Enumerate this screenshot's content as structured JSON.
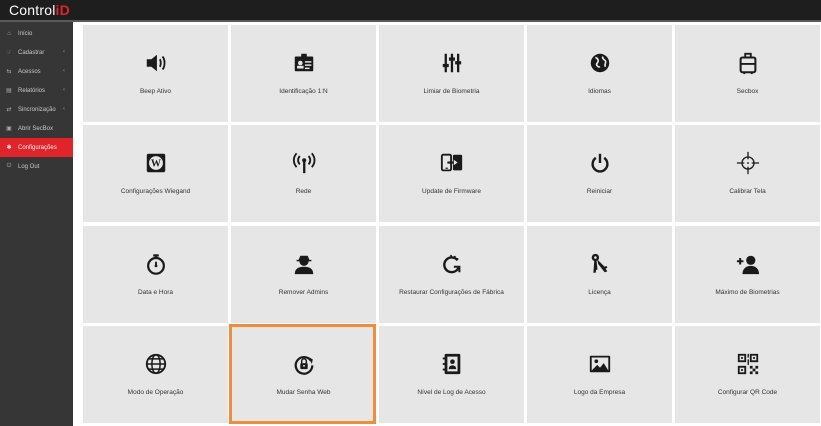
{
  "app": {
    "logo_text": "Control",
    "logo_mark": "iD"
  },
  "sidebar": {
    "items": [
      {
        "label": "Início",
        "icon": "home-icon",
        "glyph": "⌂",
        "chevron": false,
        "active": false
      },
      {
        "label": "Cadastrar",
        "icon": "add-user-icon",
        "glyph": "☞",
        "chevron": true,
        "active": false
      },
      {
        "label": "Acessos",
        "icon": "access-icon",
        "glyph": "⇆",
        "chevron": true,
        "active": false
      },
      {
        "label": "Relatórios",
        "icon": "report-icon",
        "glyph": "▤",
        "chevron": true,
        "active": false
      },
      {
        "label": "Sincronização",
        "icon": "sync-icon",
        "glyph": "⇄",
        "chevron": true,
        "active": false
      },
      {
        "label": "Abrir SecBox",
        "icon": "unlock-icon",
        "glyph": "▣",
        "chevron": false,
        "active": false
      },
      {
        "label": "Configurações",
        "icon": "settings-icon",
        "glyph": "✱",
        "chevron": false,
        "active": true
      },
      {
        "label": "Log Out",
        "icon": "logout-icon",
        "glyph": "⏻",
        "chevron": false,
        "active": false
      }
    ]
  },
  "tiles": [
    {
      "label": "Beep Ativo",
      "icon": "speaker-icon"
    },
    {
      "label": "Identificação 1:N",
      "icon": "id-card-icon"
    },
    {
      "label": "Limiar de Biometria",
      "icon": "sliders-icon"
    },
    {
      "label": "Idiomas",
      "icon": "globe-icon"
    },
    {
      "label": "Secbox",
      "icon": "luggage-icon"
    },
    {
      "label": "Configurações Wiegand",
      "icon": "wiegand-icon"
    },
    {
      "label": "Rede",
      "icon": "wireless-icon"
    },
    {
      "label": "Update de Firmware",
      "icon": "firmware-update-icon"
    },
    {
      "label": "Reiniciar",
      "icon": "power-icon"
    },
    {
      "label": "Calibrar Tela",
      "icon": "crosshair-icon"
    },
    {
      "label": "Data e Hora",
      "icon": "stopwatch-icon"
    },
    {
      "label": "Remover Admins",
      "icon": "user-spy-icon"
    },
    {
      "label": "Restaurar Configurações de Fábrica",
      "icon": "restore-icon"
    },
    {
      "label": "Licença",
      "icon": "keys-icon"
    },
    {
      "label": "Máximo de Biometrias",
      "icon": "add-user-icon"
    },
    {
      "label": "Modo de Operação",
      "icon": "globe-grid-icon"
    },
    {
      "label": "Mudar Senha Web",
      "icon": "lock-rotate-icon"
    },
    {
      "label": "Nível de Log de Acesso",
      "icon": "contact-book-icon"
    },
    {
      "label": "Logo da Empresa",
      "icon": "picture-icon"
    },
    {
      "label": "Configurar QR Code",
      "icon": "qr-code-icon"
    }
  ],
  "highlighted_tile": "Mudar Senha Web",
  "colors": {
    "brand_red": "#e2232a",
    "sidebar_bg": "#363636",
    "tile_bg": "#e6e6e6",
    "highlight_border": "#f28c38",
    "icon_color": "#1a1a1a"
  }
}
